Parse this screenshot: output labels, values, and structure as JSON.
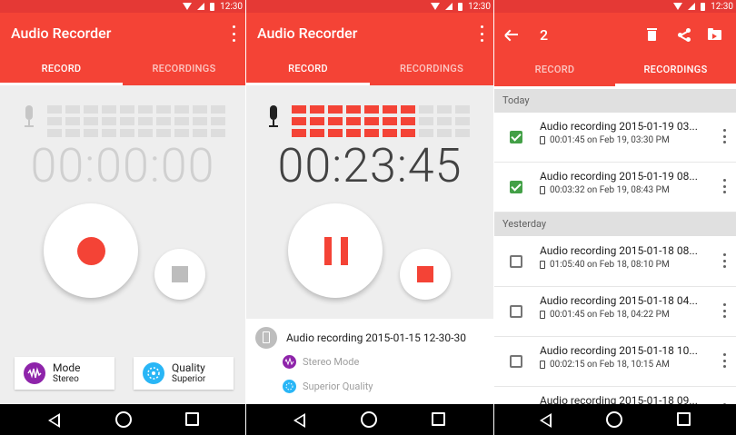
{
  "status": {
    "time": "12:30"
  },
  "app": {
    "title": "Audio Recorder"
  },
  "tabs": {
    "record": "RECORD",
    "recordings": "RECORDINGS"
  },
  "panel1": {
    "timer": "00:00:00",
    "mode": {
      "label": "Mode",
      "value": "Stereo"
    },
    "quality": {
      "label": "Quality",
      "value": "Superior"
    }
  },
  "panel2": {
    "timer": "00:23:45",
    "active_levels": 7,
    "current_file": "Audio recording 2015-01-15 12-30-30",
    "detail_mode": "Stereo Mode",
    "detail_quality": "Superior Quality"
  },
  "panel3": {
    "selected_count": "2",
    "sections": [
      {
        "label": "Today",
        "items": [
          {
            "title": "Audio recording 2015-01-19 03...",
            "meta": "00:01:45 on Feb 19, 03:30 PM",
            "checked": true
          },
          {
            "title": "Audio recording 2015-01-19 08...",
            "meta": "00:03:32 on Feb 19, 08:43 PM",
            "checked": true
          }
        ]
      },
      {
        "label": "Yesterday",
        "items": [
          {
            "title": "Audio recording 2015-01-18 08...",
            "meta": "01:05:40 on Feb 18, 08:10 PM",
            "checked": false
          },
          {
            "title": "Audio recording 2015-01-18 04...",
            "meta": "00:01:45 on Feb 18, 04:22 PM",
            "checked": false
          },
          {
            "title": "Audio recording 2015-01-18 10...",
            "meta": "00:02:15 on Feb 18, 10:15 AM",
            "checked": false
          },
          {
            "title": "Audio recording 2015-01-18 09...",
            "meta": "",
            "checked": false
          }
        ]
      }
    ]
  },
  "colors": {
    "accent": "#f44336",
    "status": "#e53935",
    "check": "#43a047",
    "mode_icon": "#8e24aa",
    "quality_icon": "#29b6f6"
  },
  "icons": [
    "wifi-icon",
    "cell-signal-icon",
    "battery-icon",
    "menu-icon",
    "mic-icon",
    "record-icon",
    "stop-icon",
    "pause-icon",
    "waveform-icon",
    "quality-icon",
    "back-arrow-icon",
    "delete-icon",
    "share-icon",
    "move-folder-icon",
    "checkbox-icon",
    "overflow-icon",
    "nav-back-icon",
    "nav-home-icon",
    "nav-recent-icon"
  ]
}
